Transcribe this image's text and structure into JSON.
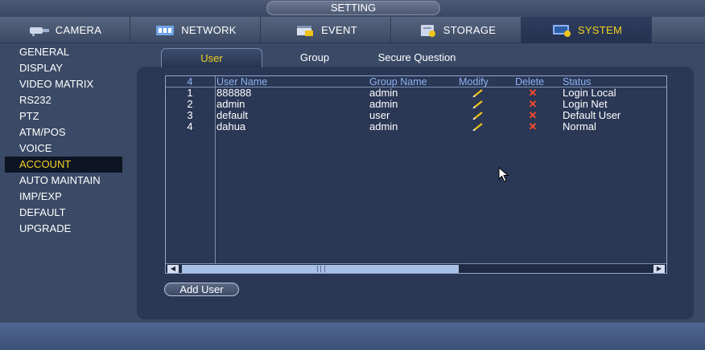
{
  "window": {
    "title": "SETTING"
  },
  "main_tabs": [
    {
      "label": "CAMERA",
      "icon": "camera-icon"
    },
    {
      "label": "NETWORK",
      "icon": "network-icon"
    },
    {
      "label": "EVENT",
      "icon": "event-icon"
    },
    {
      "label": "STORAGE",
      "icon": "storage-icon"
    },
    {
      "label": "SYSTEM",
      "icon": "system-icon",
      "active": true
    }
  ],
  "sidebar": {
    "items": [
      {
        "label": "GENERAL"
      },
      {
        "label": "DISPLAY"
      },
      {
        "label": "VIDEO MATRIX"
      },
      {
        "label": "RS232"
      },
      {
        "label": "PTZ"
      },
      {
        "label": "ATM/POS"
      },
      {
        "label": "VOICE"
      },
      {
        "label": "ACCOUNT",
        "active": true
      },
      {
        "label": "AUTO MAINTAIN"
      },
      {
        "label": "IMP/EXP"
      },
      {
        "label": "DEFAULT"
      },
      {
        "label": "UPGRADE"
      }
    ]
  },
  "sub_tabs": [
    {
      "label": "User",
      "active": true
    },
    {
      "label": "Group"
    },
    {
      "label": "Secure Question"
    }
  ],
  "user_table": {
    "count": "4",
    "columns": {
      "user_name": "User Name",
      "group_name": "Group Name",
      "modify": "Modify",
      "delete": "Delete",
      "status": "Status"
    },
    "rows": [
      {
        "num": "1",
        "user_name": "888888",
        "group_name": "admin",
        "status": "Login Local"
      },
      {
        "num": "2",
        "user_name": "admin",
        "group_name": "admin",
        "status": "Login Net"
      },
      {
        "num": "3",
        "user_name": "default",
        "group_name": "user",
        "status": "Default User"
      },
      {
        "num": "4",
        "user_name": "dahua",
        "group_name": "admin",
        "status": "Normal"
      }
    ]
  },
  "actions": {
    "add_user_label": "Add User"
  },
  "colors": {
    "accent": "#f5d21e",
    "header_text": "#8fb2f2",
    "delete_icon": "#ff4a2e",
    "modify_icon": "#f0c419",
    "panel": "#2a3755",
    "background": "#3a4a66"
  },
  "cursor_icon": "mouse-pointer-icon"
}
